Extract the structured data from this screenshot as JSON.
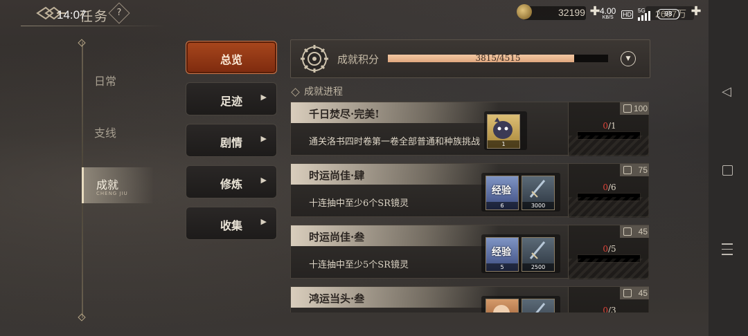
{
  "status_bar": {
    "time": "14:07",
    "network_speed_value": "4.00",
    "network_speed_unit": "KB/S",
    "hd_label": "HD",
    "signal_label": "5G",
    "battery": "98"
  },
  "header": {
    "title": "任务",
    "help_label": "?",
    "currencies": [
      {
        "icon": "coin-icon",
        "value": "32199"
      },
      {
        "icon": "gold-icon",
        "value": "2607万"
      }
    ]
  },
  "categories": [
    {
      "label": "日常",
      "active": false
    },
    {
      "label": "支线",
      "active": false
    },
    {
      "label": "成就",
      "sub": "CHENG JIU",
      "active": true
    }
  ],
  "subnav": [
    {
      "label": "总览",
      "active": true
    },
    {
      "label": "足迹",
      "active": false
    },
    {
      "label": "剧情",
      "active": false
    },
    {
      "label": "修炼",
      "active": false
    },
    {
      "label": "收集",
      "active": false
    }
  ],
  "achievement_score": {
    "title": "成就积分",
    "current": 3815,
    "max": 4515,
    "text": "3815/4515",
    "fraction": 0.845
  },
  "section_label": "成就进程",
  "achievements": [
    {
      "name": "千日焚尽·完美!",
      "desc": "通关洛书四时卷第一卷全部普通和种族挑战",
      "points": "100",
      "progress_current": "0",
      "progress_max": "/1",
      "rewards": [
        {
          "type": "gold",
          "icon": "spirit-avatar-icon",
          "qty": "1"
        }
      ]
    },
    {
      "name": "时运尚佳·肆",
      "desc": "十连抽中至少6个SR镜灵",
      "points": "75",
      "progress_current": "0",
      "progress_max": "/6",
      "rewards": [
        {
          "type": "blue",
          "icon": "exp-orb-icon",
          "overlay": "经验",
          "qty": "6"
        },
        {
          "type": "steel",
          "icon": "sword-icon",
          "qty": "3000"
        }
      ]
    },
    {
      "name": "时运尚佳·叁",
      "desc": "十连抽中至少5个SR镜灵",
      "points": "45",
      "progress_current": "0",
      "progress_max": "/5",
      "rewards": [
        {
          "type": "blue",
          "icon": "exp-orb-icon",
          "overlay": "经验",
          "qty": "5"
        },
        {
          "type": "steel",
          "icon": "sword-icon",
          "qty": "2500"
        }
      ]
    },
    {
      "name": "鸿运当头·叁",
      "desc": "",
      "points": "45",
      "progress_current": "0",
      "progress_max": "/3",
      "rewards": [
        {
          "type": "copper",
          "icon": "pouch-icon",
          "qty": ""
        },
        {
          "type": "steel",
          "icon": "sword-icon",
          "qty": ""
        }
      ]
    }
  ]
}
